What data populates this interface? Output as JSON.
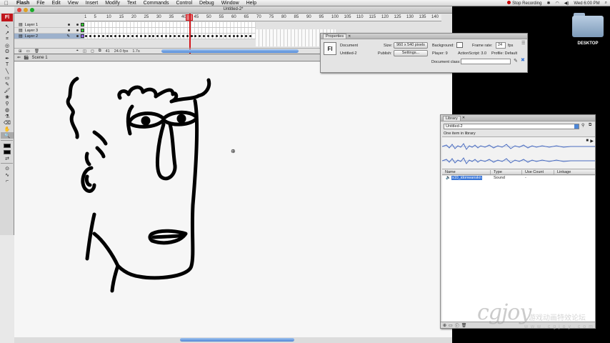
{
  "menubar": {
    "app": "Flash",
    "items": [
      "File",
      "Edit",
      "View",
      "Insert",
      "Modify",
      "Text",
      "Commands",
      "Control",
      "Debug",
      "Window",
      "Help"
    ],
    "recording": "Stop Recording",
    "clock": "Wed 6:00 PM"
  },
  "desktop": {
    "folder_label": "DESKTOP"
  },
  "document": {
    "title": "Untitled-2*"
  },
  "toolbar": {
    "logo": "Fl",
    "tools": [
      "selection-icon",
      "subselection-icon",
      "free-transform-icon",
      "3d-rotation-icon",
      "lasso-icon",
      "pen-icon",
      "text-icon",
      "line-icon",
      "rectangle-icon",
      "pencil-icon",
      "brush-icon",
      "deco-icon",
      "bone-icon",
      "paint-bucket-icon",
      "eyedropper-icon",
      "eraser-icon",
      "hand-icon",
      "zoom-icon"
    ],
    "tool_glyphs": [
      "↖",
      "↗",
      "⌗",
      "◎",
      "ʘ",
      "✒",
      "T",
      "╲",
      "▭",
      "✎",
      "🖌",
      "❀",
      "⚲",
      "◍",
      "⚗",
      "⌫",
      "✋",
      "🔍"
    ],
    "stroke_color": "#000000",
    "fill_color": "#000000"
  },
  "timeline": {
    "ruler": [
      "1",
      "5",
      "10",
      "15",
      "20",
      "25",
      "30",
      "35",
      "40",
      "45",
      "50",
      "55",
      "60",
      "65",
      "70",
      "75",
      "80",
      "85",
      "90",
      "95",
      "100",
      "105",
      "110",
      "115",
      "120",
      "125",
      "130",
      "135",
      "140"
    ],
    "layers": [
      {
        "name": "Layer 1",
        "color": "#33cc33"
      },
      {
        "name": "Layer 3",
        "color": "#33cc33"
      },
      {
        "name": "Layer 2",
        "color": "#9966ff"
      }
    ],
    "current_frame": "41",
    "frame_rate": "24.0 fps",
    "elapsed": "1.7s"
  },
  "scene": {
    "label": "Scene 1"
  },
  "properties": {
    "tab": "Properties",
    "logo": "Fl",
    "type": "Document",
    "name": "Untitled-2",
    "size_label": "Size:",
    "size_value": "960 x 540 pixels",
    "background_label": "Background:",
    "frame_rate_label": "Frame rate:",
    "frame_rate_value": "24",
    "fps": "fps",
    "publish_label": "Publish:",
    "settings_button": "Settings...",
    "player": "Player: 9",
    "actionscript": "ActionScript: 3.0",
    "profile": "Profile: Default",
    "document_class_label": "Document class:",
    "document_class_value": ""
  },
  "library": {
    "tab": "Library",
    "document_select": "Untitled-2",
    "count": "One item in library",
    "columns": [
      "Name",
      "Type",
      "Use Count",
      "Linkage"
    ],
    "items": [
      {
        "name": "s10_idonwanskn",
        "type": "Sound",
        "use_count": "-",
        "linkage": ""
      }
    ]
  },
  "watermark": {
    "logo": "cgjoy",
    "cn": "游戏动画特效论坛",
    "url": "w w w . c g j o y . c o m"
  },
  "colors": {
    "accent": "#4d86d6",
    "flash_red": "#c0151b",
    "stage_bg": "#f6f6f6"
  }
}
